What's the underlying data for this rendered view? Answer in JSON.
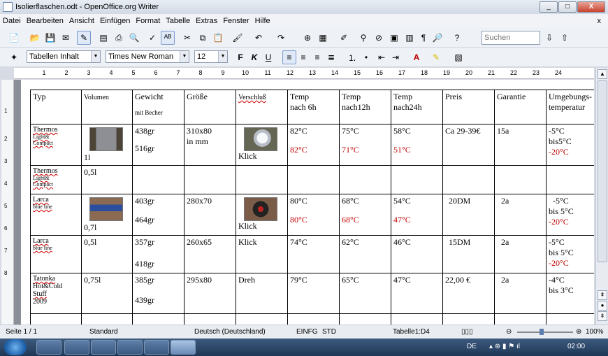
{
  "window": {
    "title": "Isolierflaschen.odt - OpenOffice.org Writer",
    "min": "_",
    "max": "□",
    "close": "X"
  },
  "menu": [
    "Datei",
    "Bearbeiten",
    "Ansicht",
    "Einfügen",
    "Format",
    "Tabelle",
    "Extras",
    "Fenster",
    "Hilfe"
  ],
  "menu_close": "x",
  "toolbar": {
    "search_placeholder": "Suchen"
  },
  "format": {
    "style": "Tabellen Inhalt",
    "font": "Times New Roman",
    "size": "12",
    "bold": "F",
    "italic": "K",
    "underline": "U"
  },
  "ruler": [
    "1",
    "2",
    "3",
    "4",
    "5",
    "6",
    "7",
    "8",
    "9",
    "10",
    "11",
    "12",
    "13",
    "14",
    "15",
    "16",
    "17",
    "18",
    "19",
    "20",
    "21",
    "22",
    "23",
    "24"
  ],
  "vruler": [
    "1",
    "2",
    "3",
    "4",
    "5",
    "6",
    "7",
    "8"
  ],
  "table": {
    "header": {
      "typ": "Typ",
      "volumen": "Volumen",
      "gewicht": "Gewicht",
      "gewicht_sub": "mit Becher",
      "groesse": "Größe",
      "verschluss": "Verschluß",
      "t6a": "Temp",
      "t6b": "nach 6h",
      "t12a": "Temp",
      "t12b": "nach12h",
      "t24a": "Temp",
      "t24b": "nach24h",
      "preis": "Preis",
      "garantie": "Garantie",
      "umg1": "Umgebungs-",
      "umg2": "temperatur"
    },
    "r1": {
      "typ1": "Thermos",
      "typ2": "Light&",
      "typ3": "Compact",
      "vol": "1l",
      "g1": "438gr",
      "g2": "516gr",
      "size1": "310x80",
      "size2": "in mm",
      "versch": "Klick",
      "t6": "82°C",
      "t6r": "82°C",
      "t12": "75°C",
      "t12r": "71°C",
      "t24": "58°C",
      "t24r": "51°C",
      "preis": "Ca 29-39€",
      "garantie": "15a",
      "u1": "-5°C",
      "u2": "bis5°C",
      "u3": "-20°C"
    },
    "r2": {
      "typ1": "Thermos",
      "typ2": "Light&",
      "typ3": "Compact",
      "vol": "0,5l"
    },
    "r3": {
      "typ1": "Larca",
      "typ2": "blue line",
      "vol": "0,7l",
      "g1": "403gr",
      "g2": "464gr",
      "size": "280x70",
      "versch": "Klick",
      "t6": "80°C",
      "t6r": "80°C",
      "t12": "68°C",
      "t12r": "68°C",
      "t24": "54°C",
      "t24r": "47°C",
      "preis": "20DM",
      "garantie": "2a",
      "u1": "-5°C",
      "u2": "bis 5°C",
      "u3": "-20°C"
    },
    "r4": {
      "typ1": "Larca",
      "typ2": "blue line",
      "vol": "0,5l",
      "g1": "357gr",
      "g2": "418gr",
      "size": "260x65",
      "versch": "Klick",
      "t6": "74°C",
      "t12": "62°C",
      "t24": "46°C",
      "preis": "15DM",
      "garantie": "2a",
      "u1": "-5°C",
      "u2": "bis 5°C",
      "u3": "-20°C"
    },
    "r5": {
      "typ1": "Tatonka",
      "typ2": "Hot&Cold",
      "typ3": "Stuff",
      "typ4": "2009",
      "vol": "0,75l",
      "g1": "385gr",
      "g2": "439gr",
      "size": "295x80",
      "versch": "Dreh",
      "t6": "79°C",
      "t12": "65°C",
      "t24": "47°C",
      "preis": "22,00 €",
      "garantie": "2a",
      "u1": "-4°C",
      "u2": "bis 3°C"
    }
  },
  "status": {
    "page": "Seite 1 / 1",
    "style": "Standard",
    "lang": "Deutsch (Deutschland)",
    "mode": "EINFG",
    "sel": "STD",
    "cell": "Tabelle1:D4",
    "zoom": "100%"
  },
  "taskbar": {
    "lang": "DE",
    "time": "02:00"
  },
  "colors": {
    "red_text": "#c00000",
    "taskbar": "#2a4566"
  }
}
